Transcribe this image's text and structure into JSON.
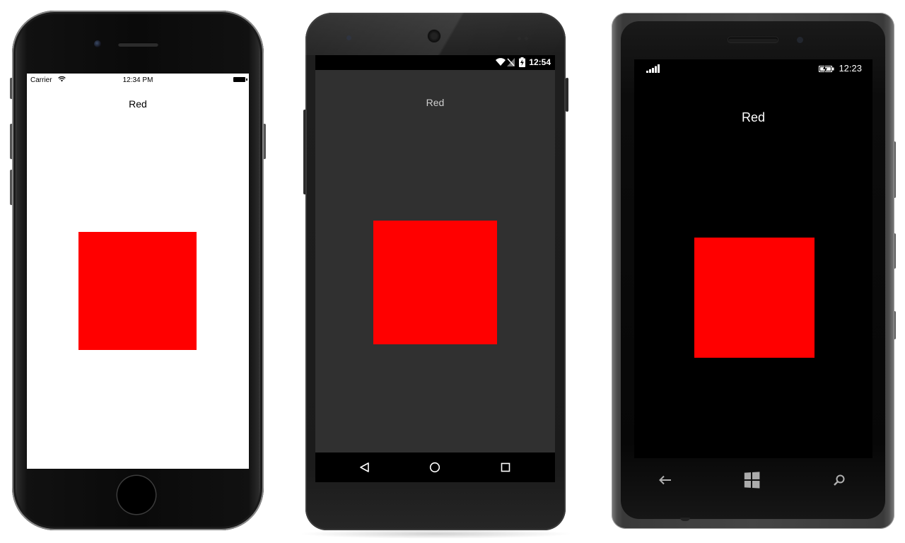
{
  "ios": {
    "status": {
      "carrier": "Carrier",
      "time": "12:34 PM"
    },
    "label": "Red",
    "box_color": "#ff0000"
  },
  "android": {
    "status": {
      "time": "12:54",
      "icons": [
        "wifi-icon",
        "no-sim-icon",
        "battery-charging-icon"
      ]
    },
    "label": "Red",
    "box_color": "#ff0000",
    "nav": [
      "back-icon",
      "home-icon",
      "recents-icon"
    ]
  },
  "windows": {
    "status": {
      "time": "12:23",
      "icons": [
        "signal-icon",
        "battery-icon"
      ]
    },
    "label": "Red",
    "box_color": "#ff0000",
    "nav": [
      "back-icon",
      "windows-start-icon",
      "search-icon"
    ]
  }
}
